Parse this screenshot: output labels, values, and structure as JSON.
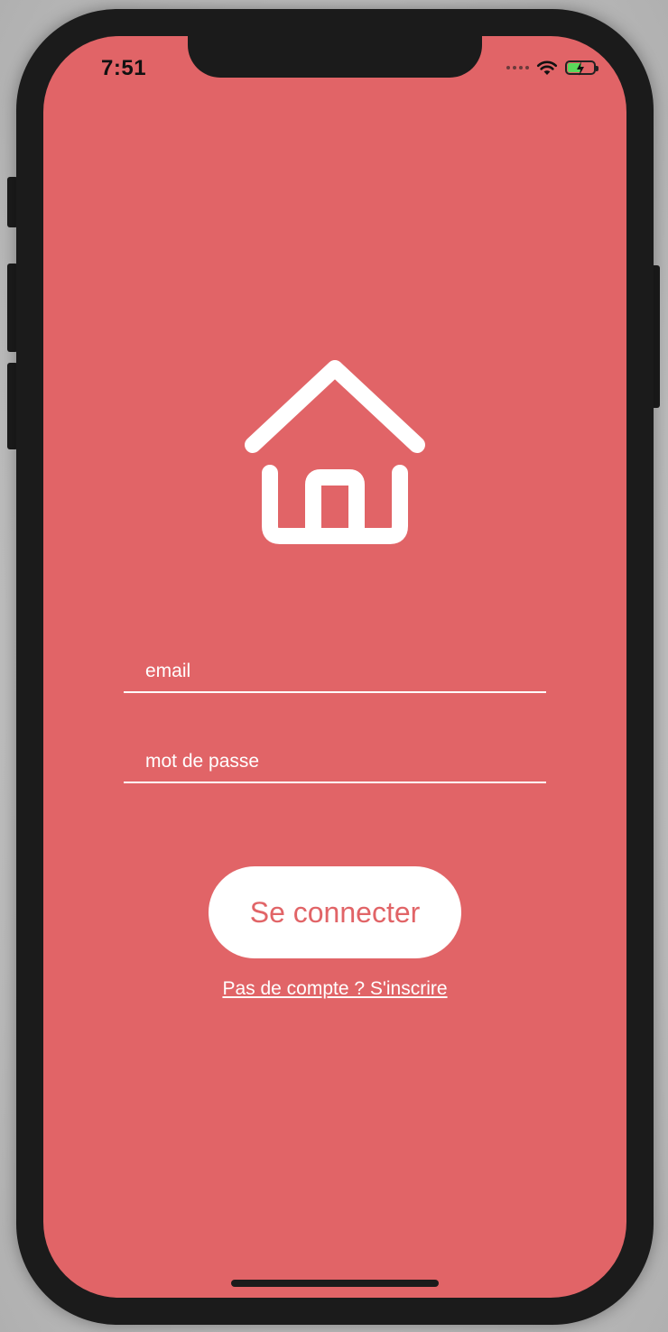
{
  "status_bar": {
    "time": "7:51",
    "battery_level": 0.55
  },
  "login": {
    "logo_icon": "home-icon",
    "email_placeholder": "email",
    "password_placeholder": "mot de passe",
    "submit_label": "Se connecter",
    "signup_link": "Pas de compte ? S'inscrire"
  },
  "theme": {
    "background": "#e16467",
    "foreground": "#ffffff"
  }
}
